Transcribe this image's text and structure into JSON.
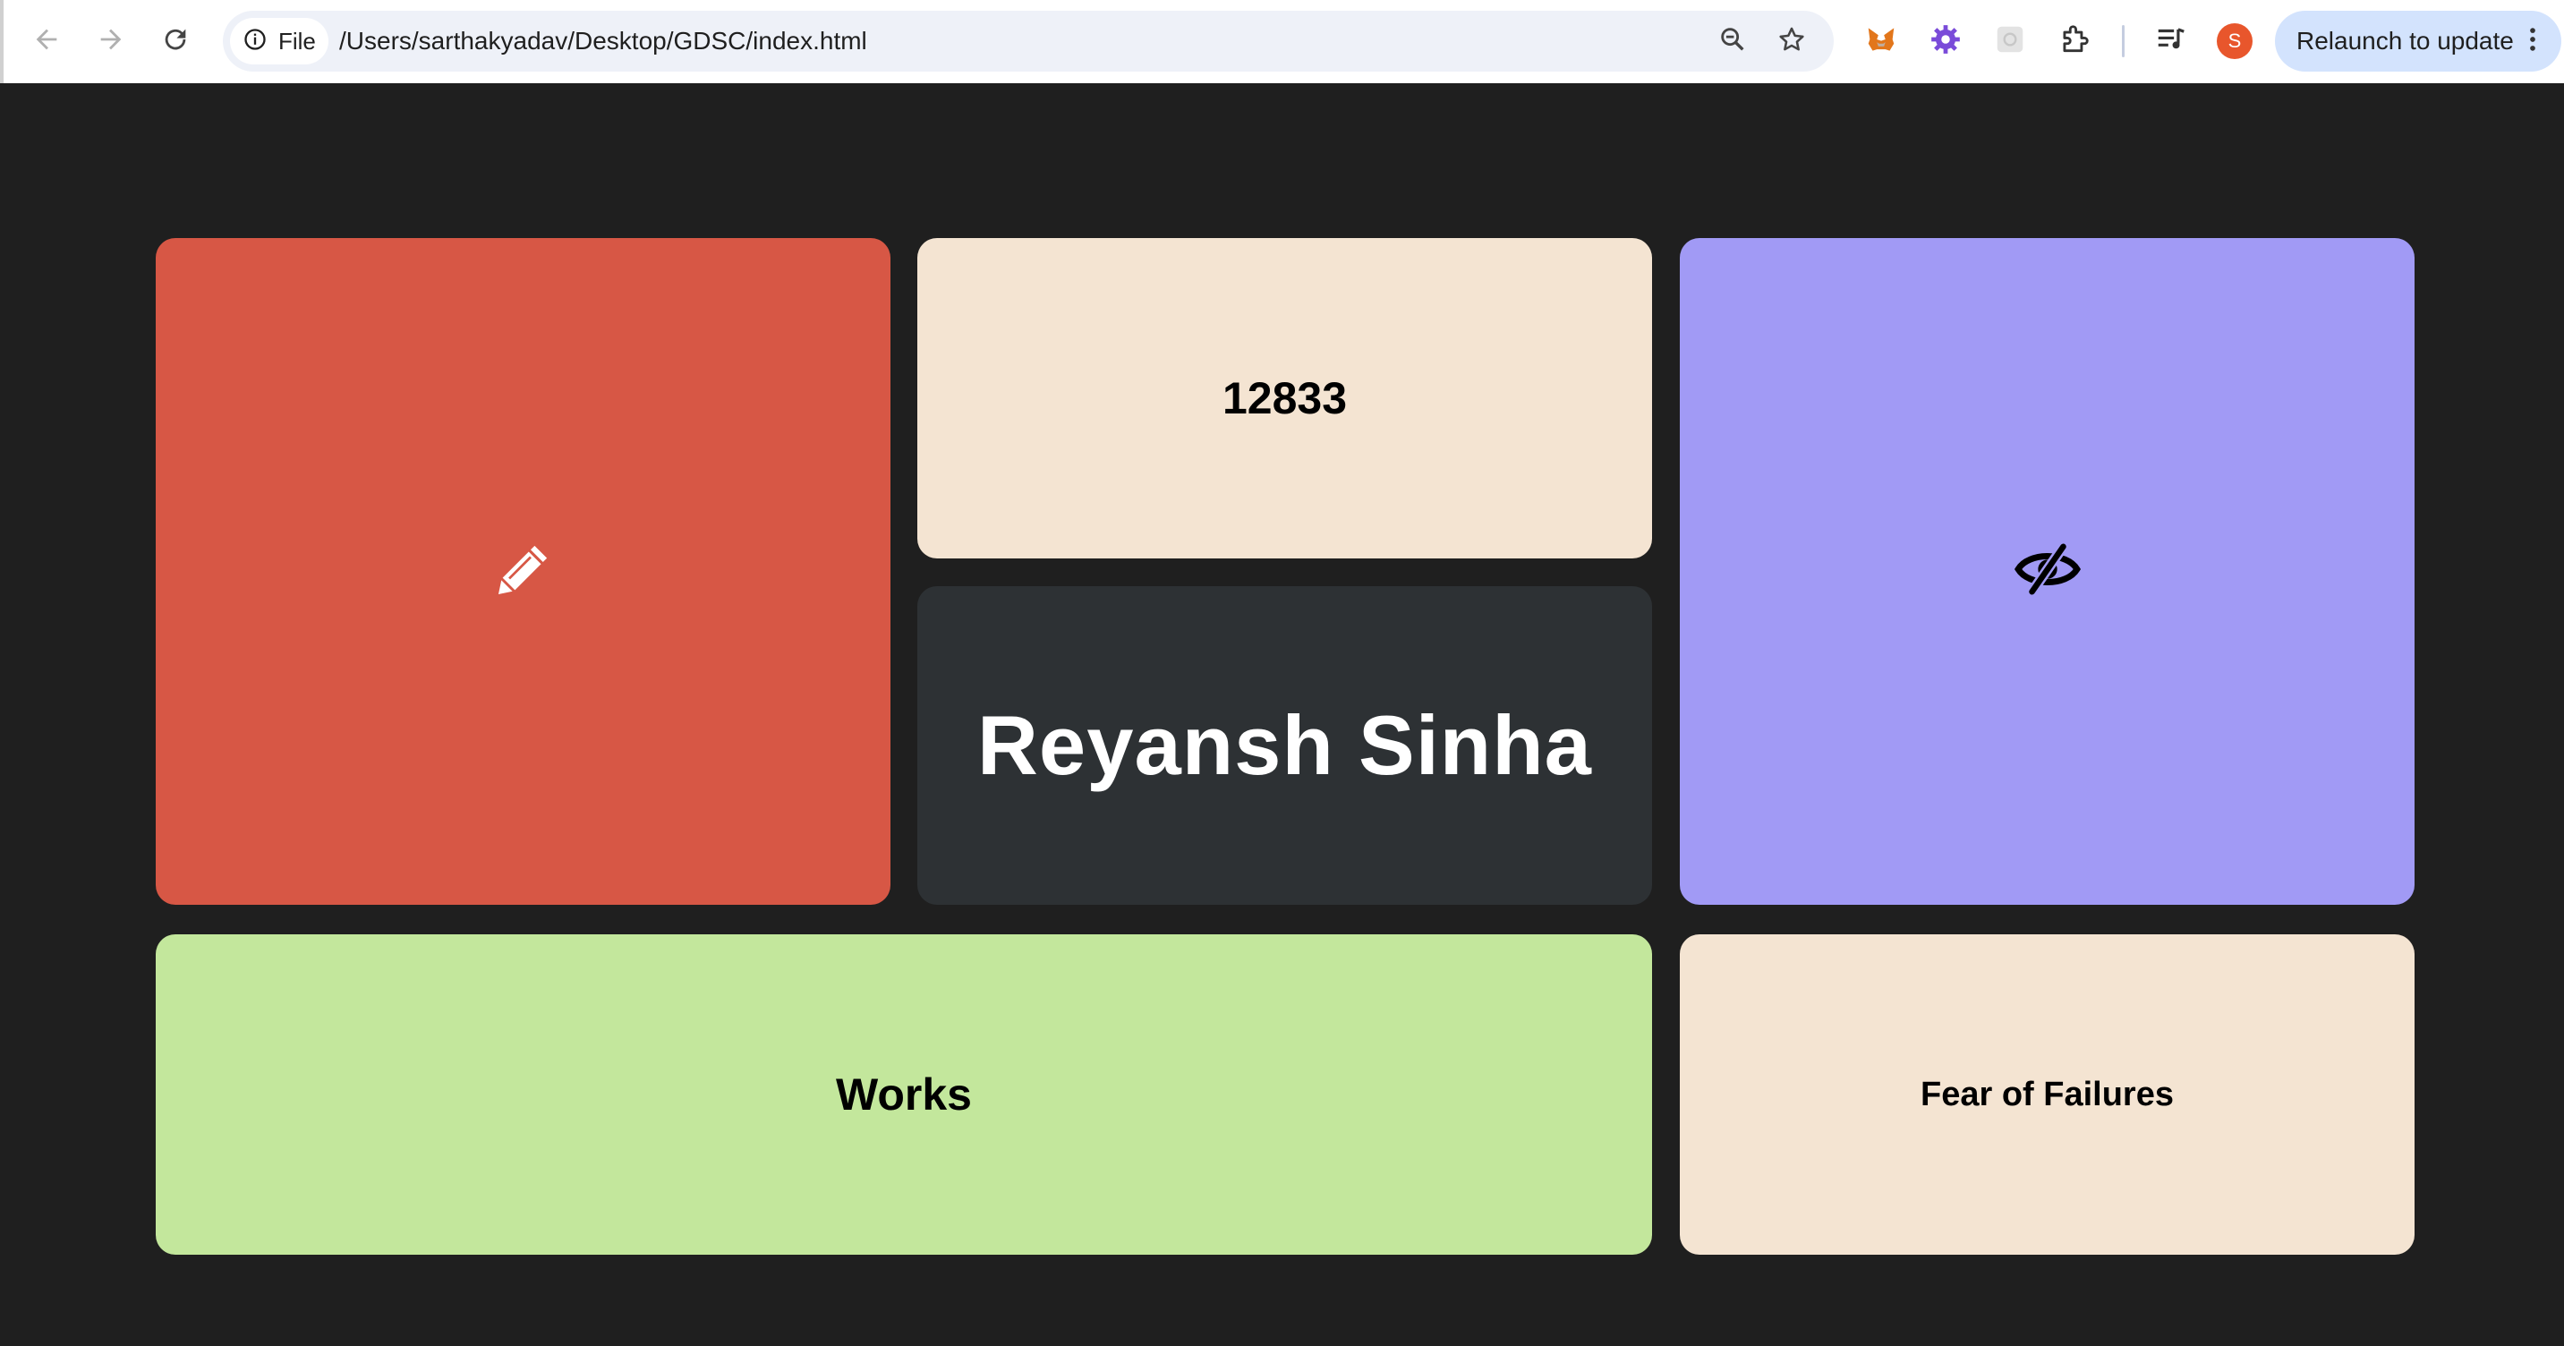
{
  "browser": {
    "site_chip_label": "File",
    "url": "/Users/sarthakyadav/Desktop/GDSC/index.html",
    "profile_initial": "S",
    "relaunch_label": "Relaunch to update",
    "toolbar_icons": [
      "back-icon",
      "forward-icon",
      "reload-icon",
      "info-icon",
      "zoom-icon",
      "bookmark-star-icon",
      "metamask-fox-icon",
      "gear-extension-icon",
      "extension-icon",
      "extensions-puzzle-icon",
      "media-queue-icon",
      "more-menu-icon"
    ]
  },
  "cards": {
    "edit_icon": "pencil-icon",
    "number": "12833",
    "hidden_icon": "eye-slash-icon",
    "name": "Reyansh Sinha",
    "works": "Works",
    "fear": "Fear of Failures"
  },
  "colors": {
    "page_bg": "#1f1f1f",
    "red_card": "#d75745",
    "cream_card": "#f4e4d2",
    "purple_card": "#a19af5",
    "dark_card": "#2d3134",
    "green_card": "#c3e79c",
    "relaunch_bg": "#d3e3fd",
    "avatar_bg": "#e8562c"
  }
}
